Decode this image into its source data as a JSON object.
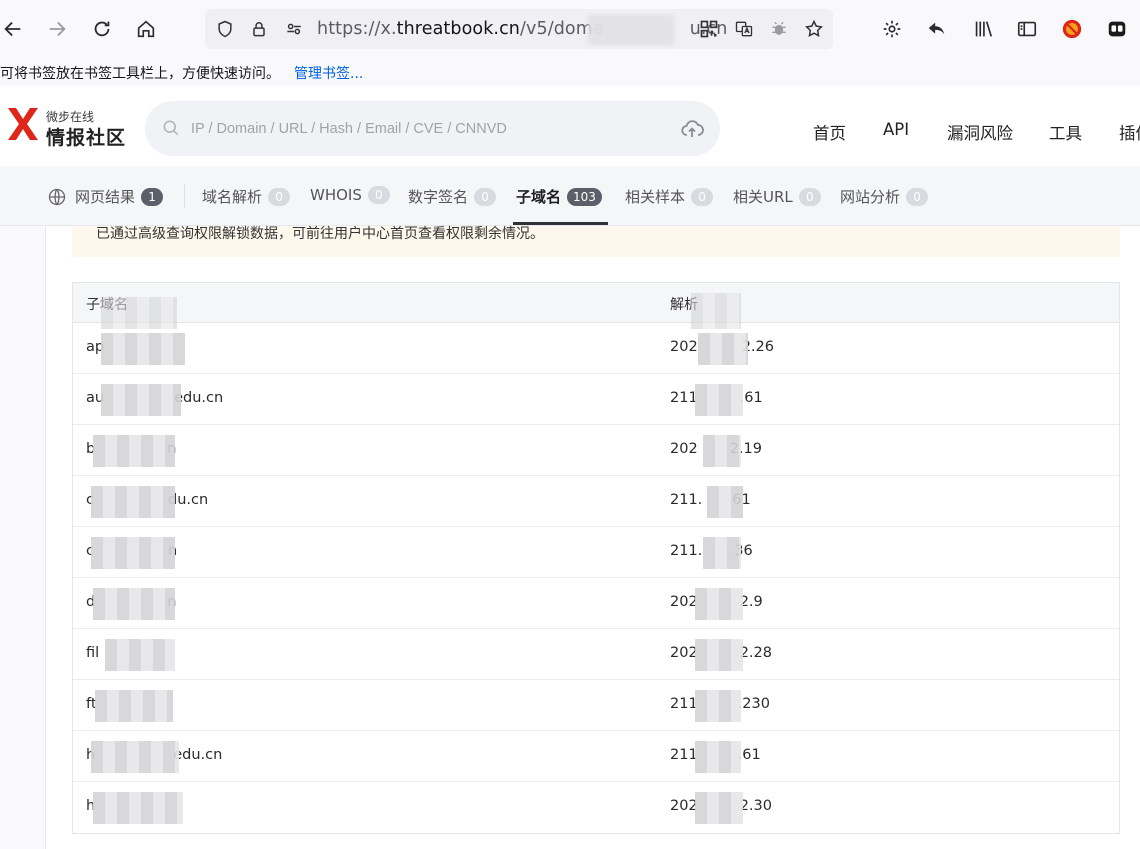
{
  "browser": {
    "url_prefix": "https://x.",
    "url_host": "threatbook.cn",
    "url_path": "/v5/doma",
    "url_suffix": "u.cn"
  },
  "bookmarks": {
    "hint": "可将书签放在书签工具栏上，方便快速访问。",
    "manage_link": "管理书签..."
  },
  "header": {
    "logo_small": "微步在线",
    "logo_big": "情报社区",
    "search_placeholder": "IP / Domain / URL / Hash / Email / CVE / CNNVD",
    "nav": [
      "首页",
      "API",
      "漏洞风险",
      "工具",
      "插件"
    ]
  },
  "tabs": [
    {
      "label": "网页结果",
      "count": "1"
    },
    {
      "label": "域名解析",
      "count": "0"
    },
    {
      "label": "WHOIS",
      "count": "0"
    },
    {
      "label": "数字签名",
      "count": "0"
    },
    {
      "label": "子域名",
      "count": "103"
    },
    {
      "label": "相关样本",
      "count": "0"
    },
    {
      "label": "相关URL",
      "count": "0"
    },
    {
      "label": "网站分析",
      "count": "0"
    }
  ],
  "notice": "已通过高级查询权限解锁数据，可前往用户中心首页查看权限剩余情况。",
  "table": {
    "headers": [
      "子域名",
      "解析"
    ],
    "rows": [
      {
        "subdomain_start": "ap",
        "subdomain_end": "",
        "ip_start": "202",
        "ip_end": "2.26"
      },
      {
        "subdomain_start": "au",
        "subdomain_end": "edu.cn",
        "ip_start": "211",
        "ip_end": ".61"
      },
      {
        "subdomain_start": "b",
        "subdomain_end": "n",
        "ip_start": "202",
        "ip_end": "2.19"
      },
      {
        "subdomain_start": "c",
        "subdomain_end": "du.cn",
        "ip_start": "211.",
        "ip_end": "61"
      },
      {
        "subdomain_start": "c",
        "subdomain_end": "n",
        "ip_start": "211.",
        "ip_end": "36"
      },
      {
        "subdomain_start": "d",
        "subdomain_end": "n",
        "ip_start": "202",
        "ip_end": "2.9"
      },
      {
        "subdomain_start": "fil",
        "subdomain_end": "",
        "ip_start": "202",
        "ip_end": "2.28"
      },
      {
        "subdomain_start": "ft",
        "subdomain_end": "",
        "ip_start": "211",
        "ip_end": ".230"
      },
      {
        "subdomain_start": "h",
        "subdomain_end": "edu.cn",
        "ip_start": "211",
        "ip_end": ".61"
      },
      {
        "subdomain_start": "h",
        "subdomain_end": "",
        "ip_start": "202",
        "ip_end": "2.30"
      }
    ]
  },
  "colors": {
    "accent_red": "#e0251b",
    "active_badge": "#5a5f68",
    "notice_bg": "#fef8ec"
  }
}
